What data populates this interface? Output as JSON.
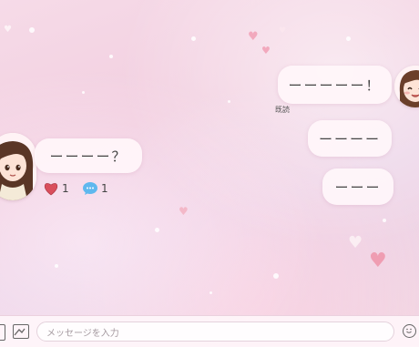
{
  "messages": {
    "incoming": {
      "text": "ーーーー？",
      "reactions": [
        {
          "icon": "heart-icon",
          "count": "1"
        },
        {
          "icon": "comment-icon",
          "count": "1"
        }
      ]
    },
    "outgoing": [
      {
        "text": "ーーーーー！",
        "status": "既読"
      },
      {
        "text": "ーーーー"
      },
      {
        "text": "ーーー"
      }
    ]
  },
  "composer": {
    "placeholder": "メッセージを入力"
  },
  "colors": {
    "background": "#f3d3e2",
    "bubble": "#fff6fa",
    "heart": "#e88fa6"
  }
}
